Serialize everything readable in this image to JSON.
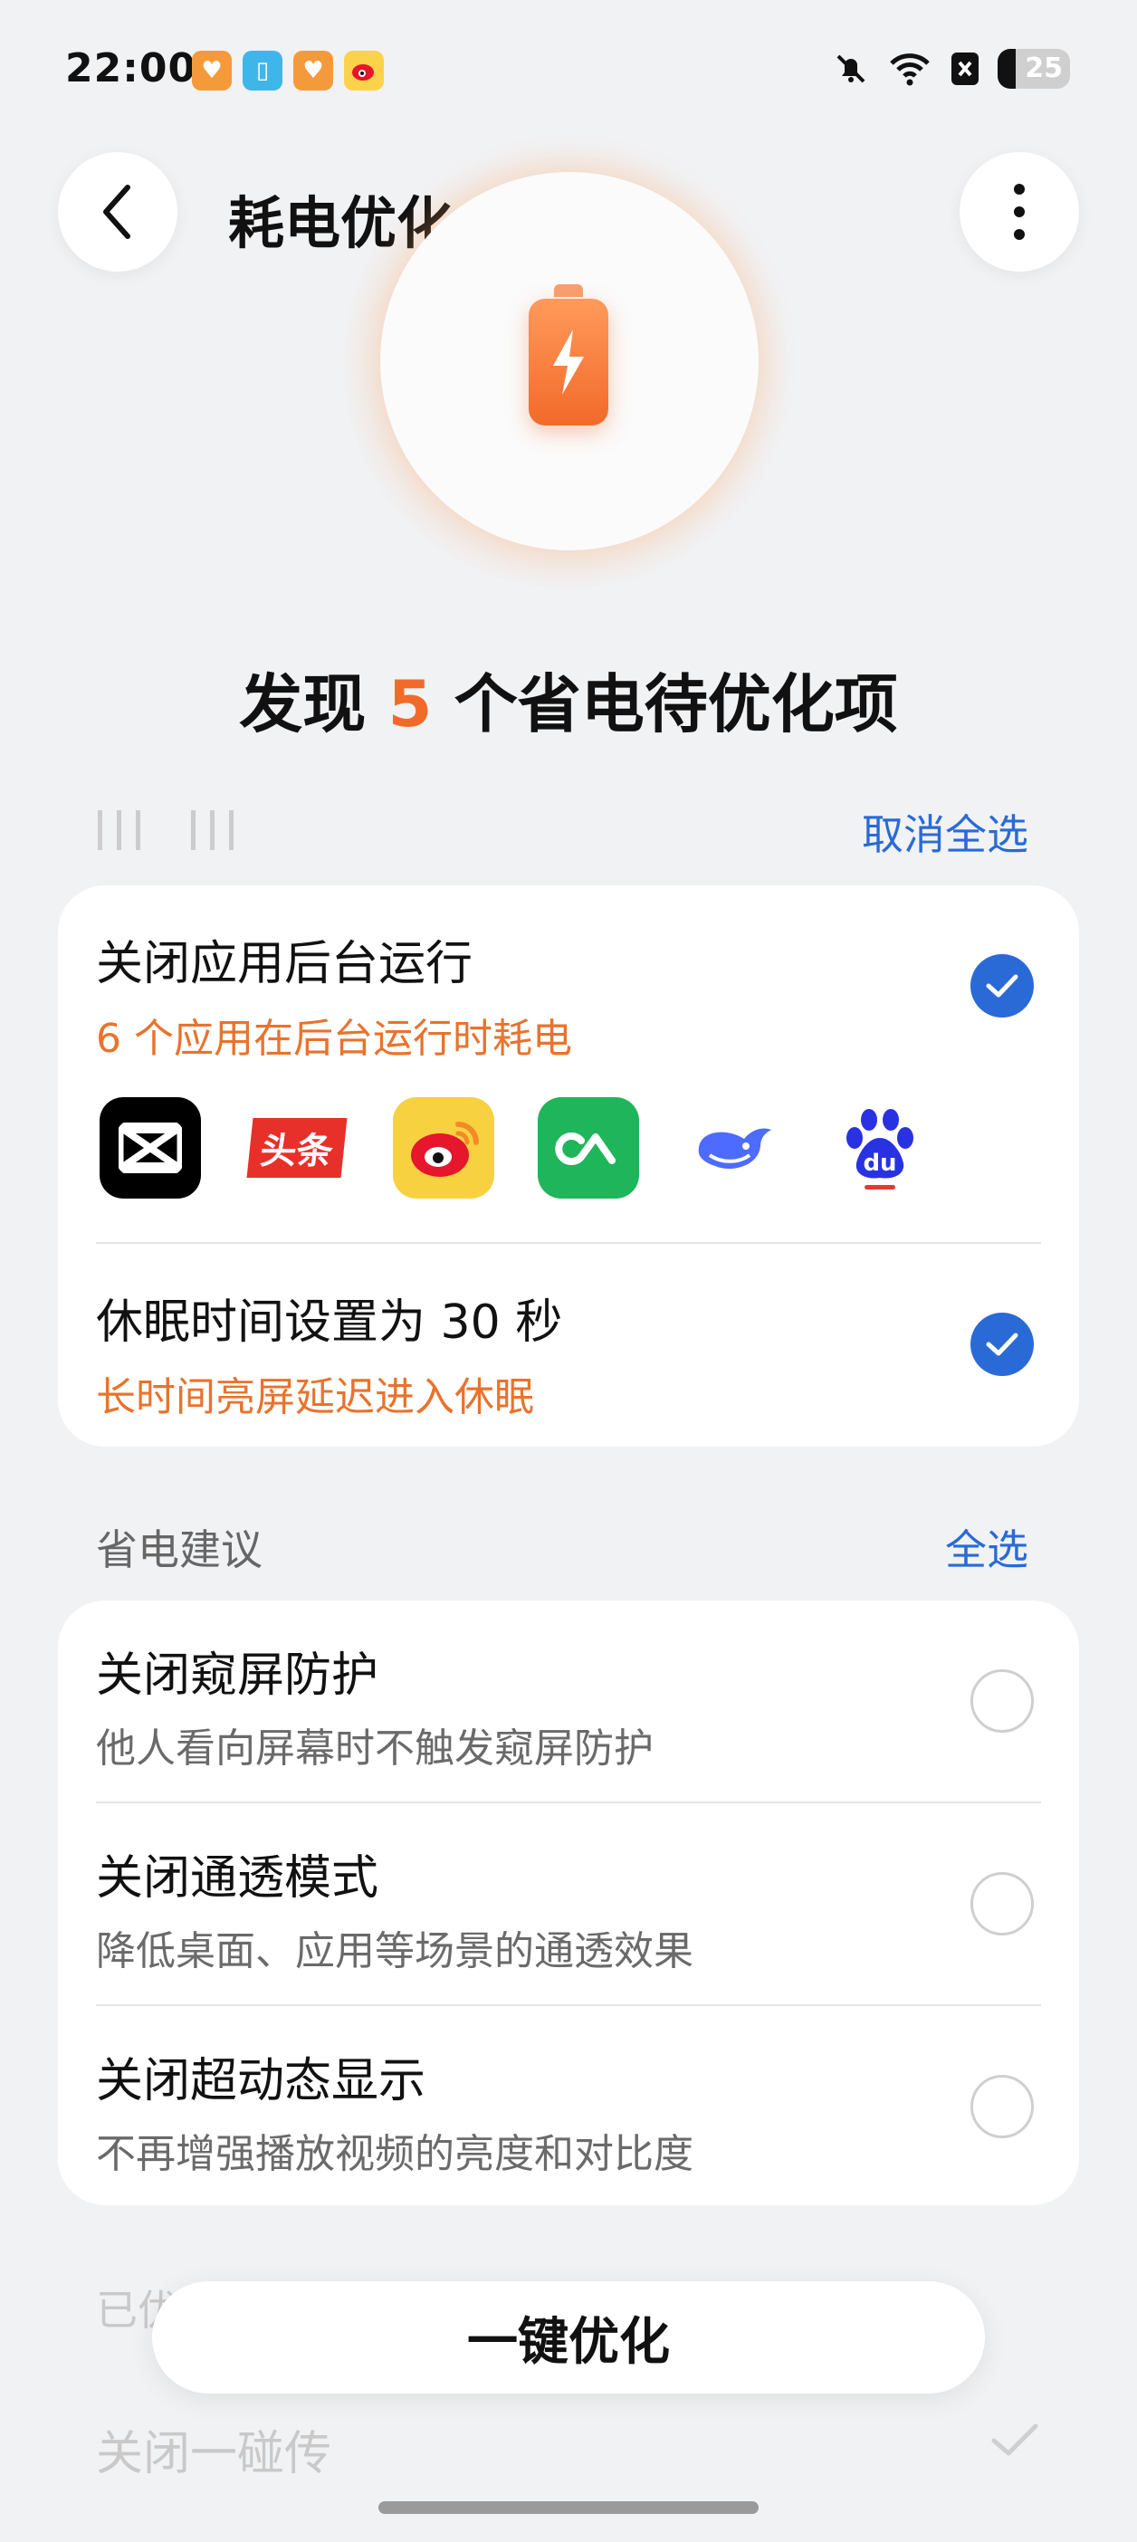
{
  "status": {
    "time": "22:00",
    "battery": "25",
    "battery_level": 0.25
  },
  "header": {
    "title": "耗电优化"
  },
  "headline": {
    "prefix": "发现 ",
    "count": "5",
    "suffix": " 个省电待优化项"
  },
  "selected_section": {
    "action": "取消全选",
    "items": [
      {
        "title": "关闭应用后台运行",
        "subtitle": "6 个应用在后台运行时耗电",
        "checked": true
      },
      {
        "title": "休眠时间设置为 30 秒",
        "subtitle": "长时间亮屏延迟进入休眠",
        "checked": true
      }
    ],
    "apps": [
      {
        "icon": "capcut-app-icon"
      },
      {
        "icon": "toutiao-app-icon",
        "label": "头条"
      },
      {
        "icon": "weibo-app-icon"
      },
      {
        "icon": "green-app-icon"
      },
      {
        "icon": "deepseek-app-icon"
      },
      {
        "icon": "baidu-app-icon",
        "label": "du"
      }
    ]
  },
  "suggestions": {
    "label": "省电建议",
    "action": "全选",
    "items": [
      {
        "title": "关闭窥屏防护",
        "subtitle": "他人看向屏幕时不触发窥屏防护",
        "checked": false
      },
      {
        "title": "关闭通透模式",
        "subtitle": "降低桌面、应用等场景的通透效果",
        "checked": false
      },
      {
        "title": "关闭超动态显示",
        "subtitle": "不再增强播放视频的亮度和对比度",
        "checked": false
      }
    ]
  },
  "optimized": {
    "label": "已优化",
    "item": "关闭一碰传"
  },
  "bottom": {
    "optimize_button": "一键优化"
  },
  "colors": {
    "accent_blue": "#2a6ad6",
    "accent_orange": "#f26a2a",
    "background": "#f1f2f4"
  }
}
